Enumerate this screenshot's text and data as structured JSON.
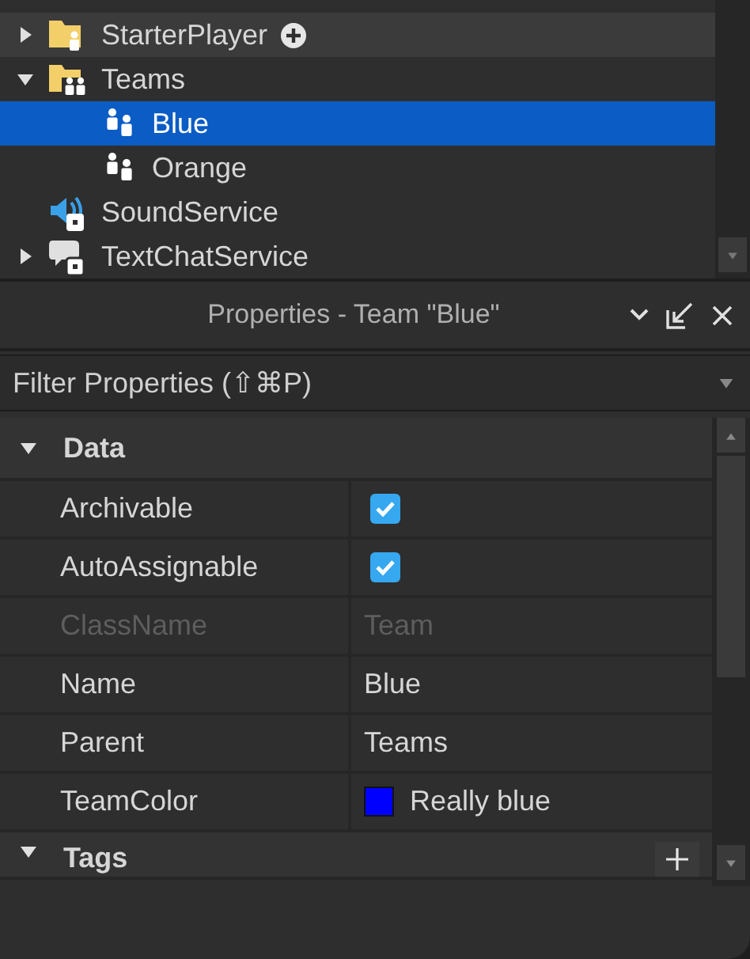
{
  "explorer": {
    "items": [
      {
        "label": "StarterPlayer",
        "kind": "folder-person",
        "expanded": false,
        "selected": false,
        "hovered": true
      },
      {
        "label": "Teams",
        "kind": "folder-people",
        "expanded": true,
        "selected": false,
        "hovered": false,
        "children": [
          {
            "label": "Blue",
            "kind": "team",
            "selected": true,
            "hovered": false
          },
          {
            "label": "Orange",
            "kind": "team",
            "selected": false,
            "hovered": false
          }
        ]
      },
      {
        "label": "SoundService",
        "kind": "sound",
        "selected": false,
        "hovered": false
      },
      {
        "label": "TextChatService",
        "kind": "chat",
        "expanded": false,
        "selected": false,
        "hovered": false
      }
    ]
  },
  "properties": {
    "title": "Properties - Team \"Blue\"",
    "filter": {
      "placeholder": "Filter Properties (⇧⌘P)"
    },
    "sections": [
      {
        "name": "Data",
        "expanded": true,
        "rows": [
          {
            "name": "Archivable",
            "kind": "checkbox",
            "checked": true,
            "disabled": false
          },
          {
            "name": "AutoAssignable",
            "kind": "checkbox",
            "checked": true,
            "disabled": false
          },
          {
            "name": "ClassName",
            "kind": "text",
            "value": "Team",
            "disabled": true
          },
          {
            "name": "Name",
            "kind": "text",
            "value": "Blue",
            "disabled": false
          },
          {
            "name": "Parent",
            "kind": "text",
            "value": "Teams",
            "disabled": false
          },
          {
            "name": "TeamColor",
            "kind": "color",
            "color": "#0000ff",
            "value": "Really blue",
            "disabled": false
          }
        ]
      },
      {
        "name": "Tags",
        "expanded": true
      }
    ]
  }
}
